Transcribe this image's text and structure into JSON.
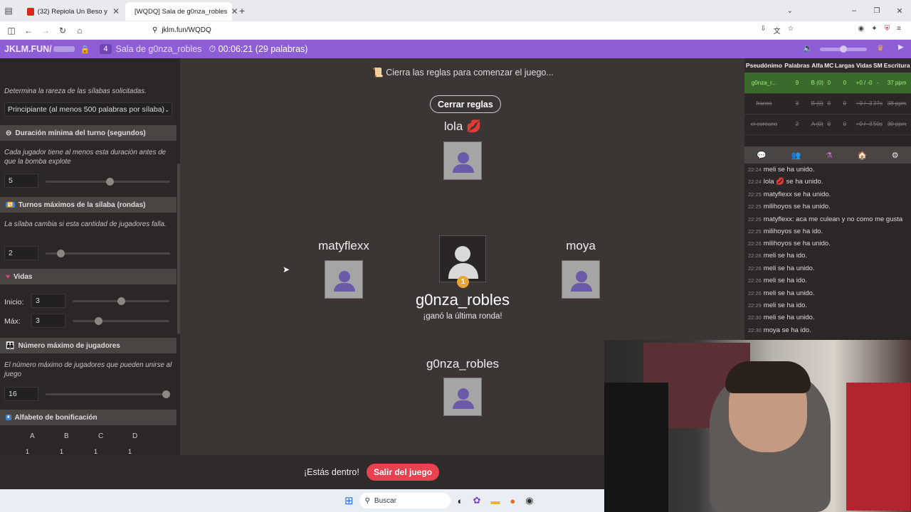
{
  "browser": {
    "tabs": [
      {
        "label": "(32) Repiola Un Beso y una Flo",
        "active": false
      },
      {
        "label": "[WQDQ] Sala de g0nza_robles",
        "active": true
      }
    ],
    "url": "jklm.fun/WQDQ"
  },
  "gamebar": {
    "brand": "JKLM.FUN/",
    "room_count": "4",
    "room_name": "Sala de g0nza_robles",
    "timer": "00:06:21 (29 palabras)"
  },
  "settings": {
    "rarity_desc": "Determina la rareza de las sílabas solicitadas.",
    "rarity_value": "Principiante (al menos 500 palabras por sílaba)",
    "min_turn": {
      "title": "Duración mínima del turno (segundos)",
      "desc": "Cada jugador tiene al menos esta duración antes de que la bomba explote",
      "value": "5",
      "level": 0.52
    },
    "max_turns": {
      "title": "Turnos máximos de la sílaba (rondas)",
      "desc": "La sílaba cambia si esta cantidad de jugadores falla.",
      "value": "2",
      "level": 0.1
    },
    "lives": {
      "title": "Vidas",
      "start_label": "Inicio:",
      "start_value": "3",
      "start_level": 0.5,
      "max_label": "Máx:",
      "max_value": "3",
      "max_level": 0.25
    },
    "max_players": {
      "title": "Número máximo de jugadores",
      "desc": "El número máximo de jugadores que pueden unirse al juego",
      "value": "16",
      "level": 1.0
    },
    "bonus": {
      "title": "Alfabeto de bonificación",
      "letters": [
        "A",
        "B",
        "C",
        "D"
      ],
      "values": [
        "1",
        "1",
        "1",
        "1"
      ]
    }
  },
  "stage": {
    "rules_notice": "Cierra las reglas para comenzar el juego...",
    "close_rules": "Cerrar reglas",
    "players": {
      "top": "lola 💋",
      "left": "matyflexx",
      "right": "moya",
      "bottom": "g0nza_robles"
    },
    "winner": {
      "name": "g0nza_robles",
      "subtitle": "¡ganó la última ronda!",
      "badge": "1"
    }
  },
  "bottom": {
    "status": "¡Estás dentro!",
    "leave": "Salir del juego"
  },
  "scoreboard": {
    "headers": [
      "Pseudónimo",
      "Palabras",
      "Alfa",
      "MC",
      "Largas",
      "Vidas",
      "SM",
      "Escritura"
    ],
    "rows": [
      {
        "cells": [
          "g0nza_r...",
          "9",
          "B (0)",
          "0",
          "0",
          "+0 / -0",
          "-",
          "37 ppm"
        ],
        "me": true
      },
      {
        "cells": [
          "franco",
          "3",
          "B (0)",
          "0",
          "0",
          "+0 / -3",
          "37s",
          "38 ppm"
        ],
        "dead": true
      },
      {
        "cells": [
          "el coreano",
          "2",
          "A (0)",
          "0",
          "0",
          "+0 / -3",
          "50s",
          "30 ppm"
        ],
        "dead": true
      }
    ]
  },
  "chat": [
    {
      "ts": "22:24",
      "text": "meli se ha unido."
    },
    {
      "ts": "22:24",
      "text": "lola 💋 se ha unido."
    },
    {
      "ts": "22:25",
      "text": "matyflexx se ha unido."
    },
    {
      "ts": "22:25",
      "text": "milihoyos  se ha unido."
    },
    {
      "ts": "22:25",
      "text": "matyflexx: aca me culean y no como me gusta"
    },
    {
      "ts": "22:25",
      "text": "milihoyos  se ha ido."
    },
    {
      "ts": "22:26",
      "text": "milihoyos  se ha unido."
    },
    {
      "ts": "22:26",
      "text": "meli se ha ido."
    },
    {
      "ts": "22:26",
      "text": "meli se ha unido."
    },
    {
      "ts": "22:26",
      "text": "meli se ha ido."
    },
    {
      "ts": "22:26",
      "text": "meli se ha unido."
    },
    {
      "ts": "22:29",
      "text": "meli se ha ido."
    },
    {
      "ts": "22:30",
      "text": "meli se ha unido."
    },
    {
      "ts": "22:30",
      "text": "moya se ha ido."
    }
  ],
  "taskbar": {
    "search": "Buscar"
  }
}
